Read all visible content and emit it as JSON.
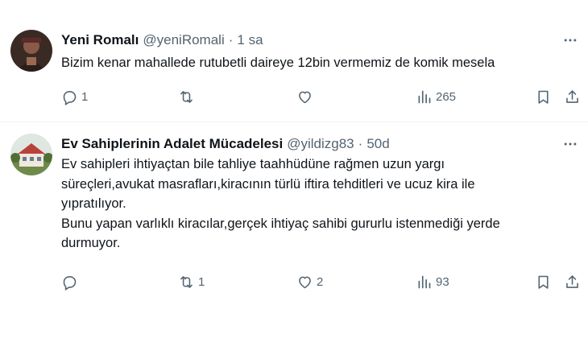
{
  "tweets": [
    {
      "author_name": "Yeni Romalı",
      "handle": "@yeniRomali",
      "separator": "·",
      "time": "1 sa",
      "text_lines": [
        "Bizim kenar mahallede rutubetli daireye 12bin vermemiz de komik mesela"
      ],
      "stats": {
        "replies": "1",
        "retweets": "",
        "likes": "",
        "views": "265"
      },
      "avatar_icon": "profile-photo-dark"
    },
    {
      "author_name": "Ev Sahiplerinin Adalet Mücadelesi",
      "handle": "@yildizg83",
      "separator": "·",
      "time": "50d",
      "text_lines": [
        "Ev sahipleri ihtiyaçtan bile tahliye taahhüdüne rağmen uzun yargı",
        "süreçleri,avukat masrafları,kiracının türlü iftira tehditleri ve ucuz kira ile",
        "yıpratılıyor.",
        "Bunu yapan varlıklı kiracılar,gerçek ihtiyaç sahibi gururlu istenmediği yerde",
        "durmuyor."
      ],
      "stats": {
        "replies": "",
        "retweets": "1",
        "likes": "2",
        "views": "93"
      },
      "avatar_icon": "profile-photo-house"
    }
  ],
  "colors": {
    "text": "#0f1419",
    "secondary": "#536471",
    "divider": "#eff3f4",
    "background": "#ffffff"
  },
  "icons": [
    "reply-icon",
    "retweet-icon",
    "like-icon",
    "views-icon",
    "bookmark-icon",
    "share-icon",
    "more-icon"
  ]
}
